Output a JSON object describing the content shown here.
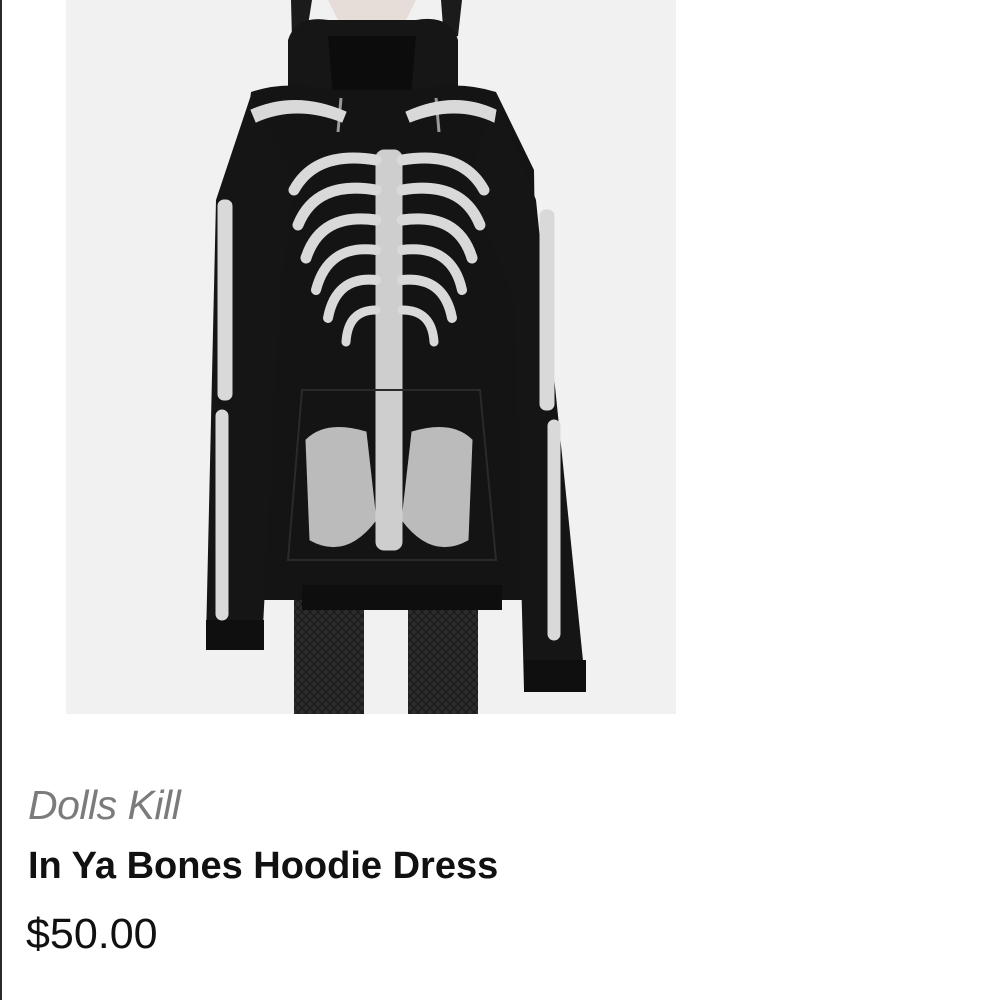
{
  "product": {
    "brand": "Dolls Kill",
    "title": "In Ya Bones Hoodie Dress",
    "price": "$50.00"
  },
  "colors": {
    "background": "#ffffff",
    "photo_background": "#f1f1f1",
    "brand_text": "#7b7b7b",
    "title_text": "#111111",
    "garment": "#121212",
    "bone_print": "#d9d9d9"
  }
}
